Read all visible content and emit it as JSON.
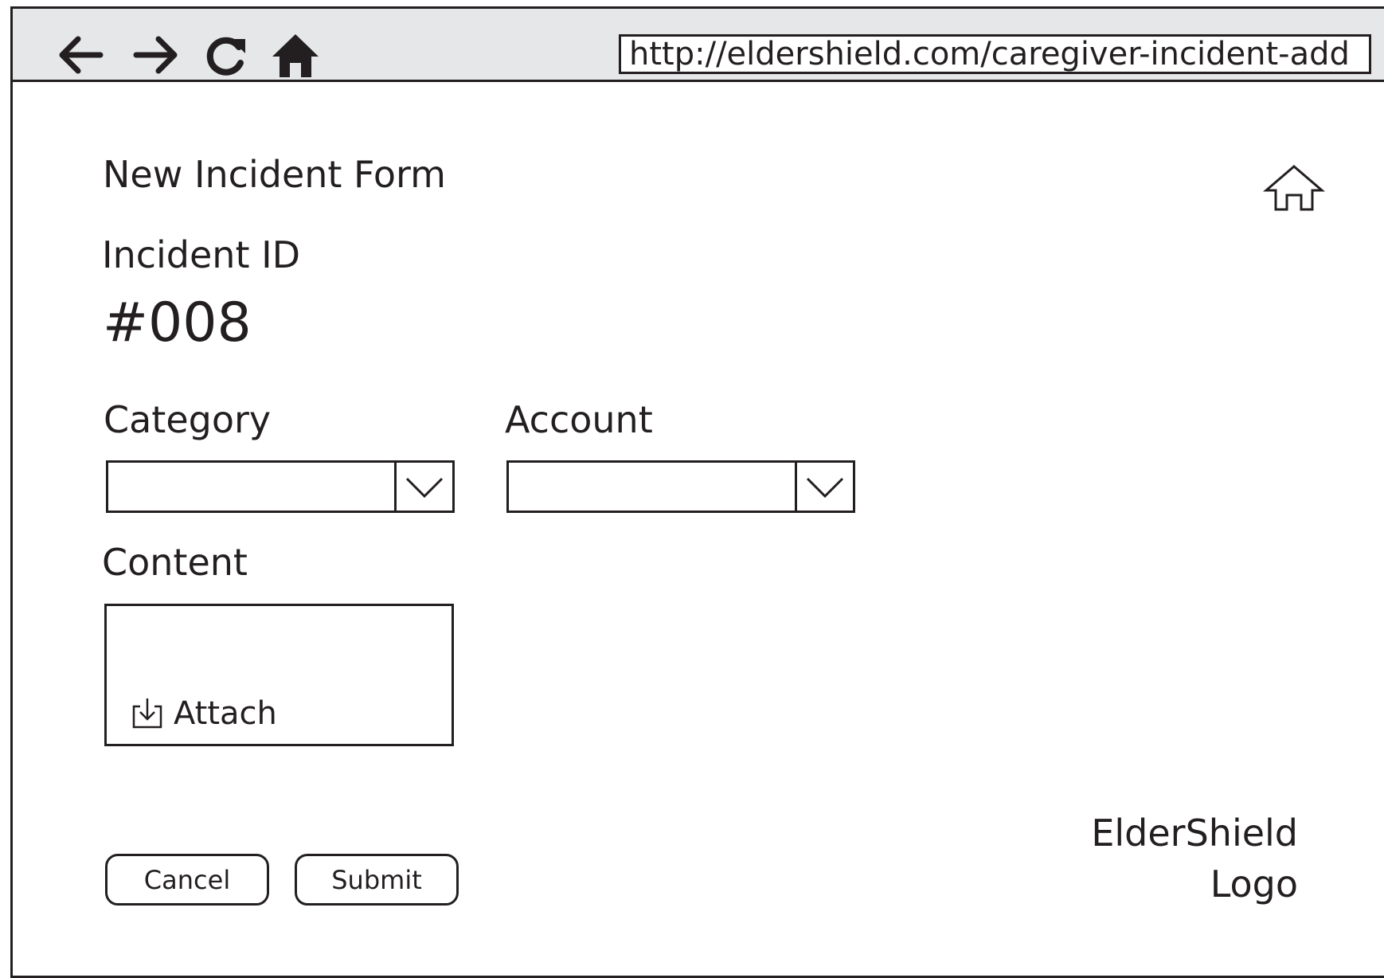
{
  "browser": {
    "url": "http://eldershield.com/caregiver-incident-add"
  },
  "form": {
    "title": "New Incident Form",
    "incident_id_label": "Incident ID",
    "incident_id_value": "#008",
    "category": {
      "label": "Category",
      "value": ""
    },
    "account": {
      "label": "Account",
      "value": ""
    },
    "content": {
      "label": "Content",
      "value": "",
      "attach_label": "Attach"
    }
  },
  "actions": {
    "cancel_label": "Cancel",
    "submit_label": "Submit"
  },
  "branding": {
    "logo_line1": "ElderShield",
    "logo_line2": "Logo"
  }
}
